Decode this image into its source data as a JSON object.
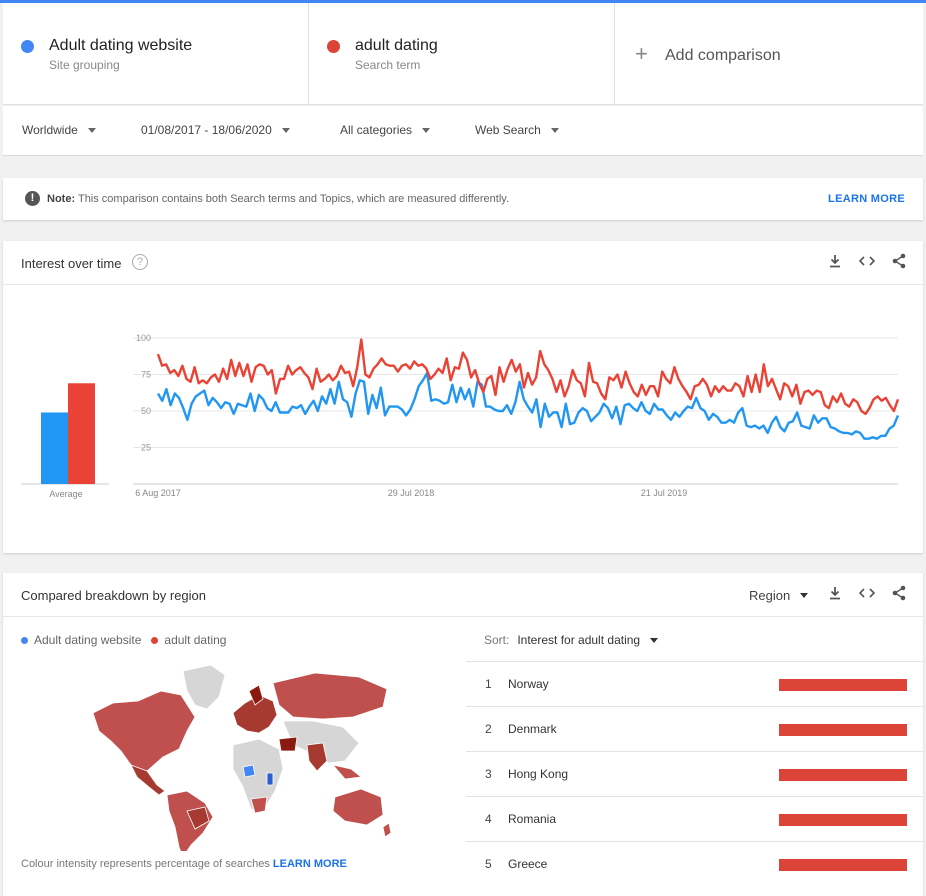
{
  "terms": [
    {
      "name": "Adult dating website",
      "sub": "Site grouping",
      "color": "#4285f4"
    },
    {
      "name": "adult dating",
      "sub": "Search term",
      "color": "#db4437"
    }
  ],
  "add_comparison": "Add comparison",
  "filters": {
    "region": "Worldwide",
    "date": "01/08/2017 - 18/06/2020",
    "category": "All categories",
    "search_type": "Web Search"
  },
  "note": {
    "bold": "Note:",
    "text": "This comparison contains both Search terms and Topics, which are measured differently.",
    "link": "LEARN MORE"
  },
  "interest": {
    "title": "Interest over time",
    "average_label": "Average",
    "help_icon": "question-icon"
  },
  "chart_data": {
    "type": "line",
    "ylim": [
      0,
      100
    ],
    "yticks": [
      "100",
      "75",
      "50",
      "25"
    ],
    "xticks": [
      "6 Aug 2017",
      "29 Jul 2018",
      "21 Jul 2019"
    ],
    "averages": [
      49,
      69
    ],
    "series": [
      {
        "name": "Adult dating website",
        "color": "#2196f3",
        "values": [
          62,
          57,
          65,
          54,
          62,
          59,
          52,
          44,
          55,
          60,
          62,
          64,
          54,
          59,
          56,
          52,
          56,
          55,
          48,
          55,
          54,
          53,
          62,
          50,
          61,
          58,
          52,
          50,
          56,
          49,
          49,
          49,
          53,
          52,
          54,
          48,
          53,
          57,
          50,
          60,
          55,
          65,
          55,
          70,
          58,
          56,
          46,
          62,
          71,
          70,
          48,
          61,
          52,
          66,
          47,
          53,
          53,
          53,
          51,
          47,
          51,
          58,
          67,
          71,
          76,
          57,
          58,
          57,
          55,
          56,
          68,
          56,
          66,
          58,
          65,
          53,
          70,
          68,
          53,
          53,
          51,
          50,
          50,
          54,
          48,
          56,
          70,
          58,
          53,
          49,
          58,
          39,
          55,
          46,
          49,
          49,
          39,
          55,
          41,
          42,
          49,
          52,
          50,
          43,
          46,
          49,
          55,
          52,
          45,
          53,
          41,
          54,
          55,
          52,
          50,
          56,
          50,
          48,
          55,
          51,
          51,
          47,
          44,
          49,
          46,
          50,
          53,
          52,
          59,
          52,
          50,
          44,
          48,
          46,
          42,
          42,
          44,
          42,
          49,
          52,
          40,
          39,
          40,
          38,
          40,
          35,
          42,
          46,
          39,
          36,
          42,
          43,
          49,
          40,
          39,
          38,
          47,
          42,
          45,
          45,
          39,
          38,
          36,
          35,
          35,
          34,
          36,
          35,
          31,
          31,
          32,
          31,
          33,
          33,
          38,
          40,
          47
        ]
      },
      {
        "name": "adult dating",
        "color": "#ea4335",
        "values": [
          89,
          81,
          82,
          76,
          78,
          74,
          81,
          72,
          70,
          80,
          69,
          71,
          69,
          73,
          75,
          70,
          79,
          72,
          85,
          74,
          83,
          74,
          82,
          70,
          80,
          82,
          81,
          75,
          78,
          62,
          72,
          72,
          81,
          75,
          78,
          80,
          76,
          73,
          65,
          79,
          70,
          72,
          75,
          71,
          74,
          81,
          76,
          77,
          67,
          80,
          99,
          75,
          73,
          79,
          82,
          86,
          82,
          81,
          81,
          77,
          81,
          82,
          79,
          84,
          81,
          82,
          79,
          72,
          75,
          79,
          76,
          86,
          71,
          80,
          79,
          90,
          85,
          73,
          78,
          69,
          63,
          72,
          74,
          61,
          80,
          70,
          79,
          85,
          77,
          82,
          66,
          76,
          68,
          73,
          91,
          82,
          78,
          72,
          63,
          71,
          60,
          67,
          78,
          71,
          69,
          60,
          83,
          70,
          69,
          62,
          58,
          73,
          71,
          75,
          66,
          77,
          69,
          63,
          60,
          68,
          61,
          67,
          67,
          60,
          77,
          72,
          69,
          80,
          72,
          67,
          63,
          58,
          67,
          68,
          72,
          68,
          60,
          67,
          63,
          67,
          64,
          64,
          69,
          67,
          60,
          74,
          63,
          75,
          63,
          82,
          67,
          72,
          65,
          58,
          69,
          67,
          60,
          68,
          55,
          63,
          64,
          61,
          64,
          63,
          54,
          52,
          60,
          56,
          62,
          55,
          53,
          58,
          56,
          50,
          48,
          52,
          58,
          60,
          57,
          59,
          54,
          50,
          58
        ]
      }
    ]
  },
  "breakdown": {
    "title": "Compared breakdown by region",
    "region_select": "Region",
    "legend": [
      "Adult dating website",
      "adult dating"
    ],
    "sort_label": "Sort:",
    "sort_value": "Interest for adult dating",
    "footer_text": "Colour intensity represents percentage of searches",
    "footer_link": "LEARN MORE",
    "rows": [
      {
        "rank": "1",
        "country": "Norway",
        "value": 100
      },
      {
        "rank": "2",
        "country": "Denmark",
        "value": 100
      },
      {
        "rank": "3",
        "country": "Hong Kong",
        "value": 100
      },
      {
        "rank": "4",
        "country": "Romania",
        "value": 100
      },
      {
        "rank": "5",
        "country": "Greece",
        "value": 100
      }
    ]
  },
  "icons": {
    "download": "download-icon",
    "embed": "embed-icon",
    "share": "share-icon",
    "note": "info-icon",
    "add": "plus-icon"
  }
}
